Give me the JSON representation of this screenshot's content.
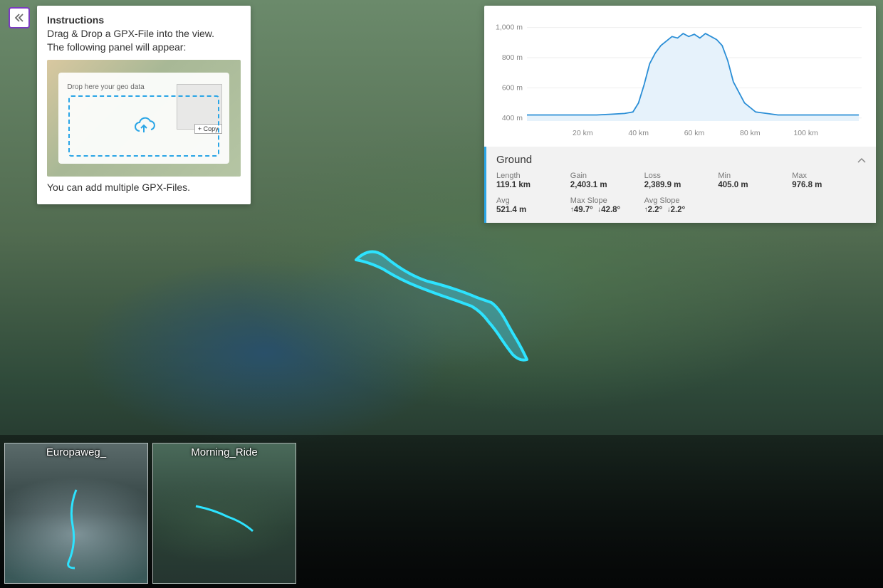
{
  "instructions": {
    "title": "Instructions",
    "line1": "Drag & Drop a GPX-File into the view.",
    "line2": "The following panel will appear:",
    "drop_hint": "Drop here your geo data",
    "copy_label": "+ Copy",
    "line3": "You can add multiple GPX-Files."
  },
  "profile": {
    "section_title": "Ground",
    "stats": {
      "length_label": "Length",
      "length_value": "119.1 km",
      "gain_label": "Gain",
      "gain_value": "2,403.1 m",
      "loss_label": "Loss",
      "loss_value": "2,389.9 m",
      "min_label": "Min",
      "min_value": "405.0 m",
      "max_label": "Max",
      "max_value": "976.8 m",
      "avg_label": "Avg",
      "avg_value": "521.4 m",
      "max_slope_label": "Max Slope",
      "max_slope_up": "49.7°",
      "max_slope_down": "42.8°",
      "avg_slope_label": "Avg Slope",
      "avg_slope_up": "2.2°",
      "avg_slope_down": "2.2°"
    }
  },
  "chart_data": {
    "type": "area",
    "title": "",
    "xlabel": "",
    "ylabel": "",
    "x_unit": "km",
    "y_unit": "m",
    "y_ticks": [
      400,
      600,
      800,
      1000
    ],
    "y_tick_labels": [
      "400 m",
      "600 m",
      "800 m",
      "1,000 m"
    ],
    "x_ticks": [
      20,
      40,
      60,
      80,
      100
    ],
    "x_tick_labels": [
      "20 km",
      "40 km",
      "60 km",
      "80 km",
      "100 km"
    ],
    "xlim": [
      0,
      120
    ],
    "ylim": [
      380,
      1050
    ],
    "series": [
      {
        "name": "Ground",
        "color": "#2a8ed6",
        "x": [
          0,
          5,
          10,
          15,
          20,
          25,
          30,
          35,
          38,
          40,
          42,
          44,
          46,
          48,
          50,
          52,
          54,
          56,
          58,
          60,
          62,
          64,
          66,
          68,
          70,
          72,
          74,
          78,
          82,
          86,
          90,
          95,
          100,
          108,
          115,
          119
        ],
        "values": [
          420,
          420,
          420,
          420,
          420,
          420,
          425,
          430,
          440,
          500,
          620,
          760,
          830,
          880,
          910,
          940,
          930,
          960,
          940,
          955,
          930,
          960,
          940,
          920,
          880,
          780,
          640,
          500,
          440,
          430,
          420,
          420,
          420,
          420,
          420,
          420
        ]
      }
    ]
  },
  "thumbnails": [
    {
      "title": "Europaweg_"
    },
    {
      "title": "Morning_Ride"
    }
  ]
}
